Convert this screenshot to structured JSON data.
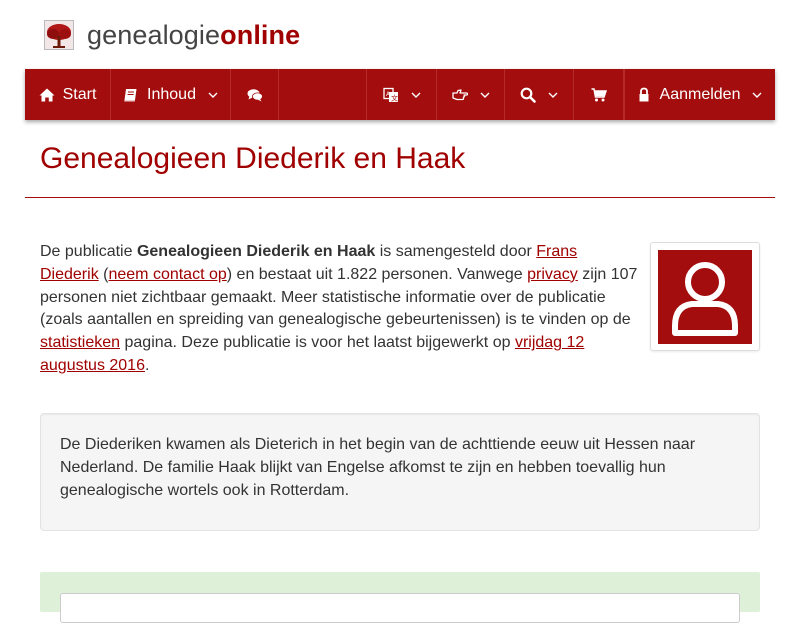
{
  "logo": {
    "part1": "genealogie",
    "part2": "online",
    "icon": "tree-icon"
  },
  "nav": {
    "start_label": "Start",
    "inhoud_label": "Inhoud",
    "aanmelden_label": "Aanmelden",
    "icons": [
      "home-icon",
      "book-icon",
      "comments-icon",
      "language-icon",
      "hand-pointer-icon",
      "search-icon",
      "cart-icon",
      "lock-icon",
      "chevron-down-icon"
    ]
  },
  "page": {
    "title": "Genealogieen Diederik en Haak"
  },
  "intro": {
    "t1": "De publicatie ",
    "pub_name": "Genealogieen Diederik en Haak",
    "t2": " is samengesteld door ",
    "author_link": "Frans Diederik",
    "t3": " (",
    "contact_link": "neem contact op",
    "t4": ") en bestaat uit 1.822 personen. Vanwege ",
    "privacy_link": "privacy",
    "t5": " zijn 107 personen niet zichtbaar gemaakt. Meer statistische informatie over de publicatie (zoals aantallen en spreiding van genealogische gebeurtenissen) is te vinden op de ",
    "stats_link": "statistieken",
    "t6": " pagina. Deze publicatie is voor het laatst bijgewerkt op ",
    "date_link": "vrijdag 12 augustus 2016",
    "t7": "."
  },
  "description": "De Diederiken kwamen als Dieterich in het begin van de achttiende eeuw uit Hessen naar Nederland. De familie Haak blijkt van Engelse afkomst te zijn en hebben toevallig hun genealogische wortels ook in Rotterdam.",
  "colors": {
    "brand": "#a30d0d",
    "link": "#a00000",
    "panel": "#dff0d8"
  }
}
